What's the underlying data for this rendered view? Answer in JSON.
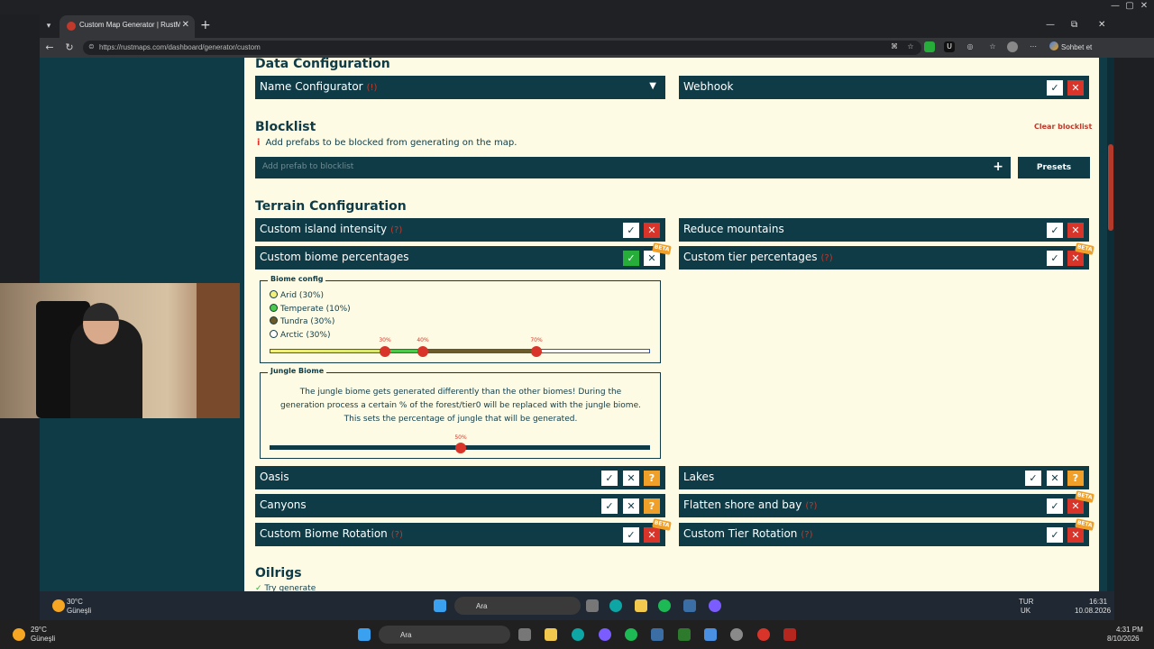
{
  "browser": {
    "tab_title": "Custom Map Generator | RustMaps",
    "url": "https://rustmaps.com/dashboard/generator/custom",
    "chat_button": "Sohbet et"
  },
  "data_config": {
    "title": "Data Configuration",
    "name_configurator": "Name Configurator",
    "name_configurator_hint": "(!)",
    "webhook": "Webhook"
  },
  "blocklist": {
    "title": "Blocklist",
    "clear": "Clear blocklist",
    "info": "Add prefabs to be blocked from generating on the map.",
    "placeholder": "Add prefab to blocklist",
    "presets": "Presets"
  },
  "terrain": {
    "title": "Terrain Configuration",
    "custom_island": "Custom island intensity",
    "reduce_mountains": "Reduce mountains",
    "custom_biome": "Custom biome percentages",
    "custom_tier": "Custom tier percentages",
    "oasis": "Oasis",
    "lakes": "Lakes",
    "canyons": "Canyons",
    "flatten_shore": "Flatten shore and bay",
    "biome_rotation": "Custom Biome Rotation",
    "tier_rotation": "Custom Tier Rotation",
    "help_mark": "(?)",
    "beta": "BETA",
    "question": "?"
  },
  "biome_config": {
    "legend": "Biome config",
    "items": [
      {
        "label": "Arid (30%)",
        "color": "#f3f07a"
      },
      {
        "label": "Temperate (10%)",
        "color": "#4cc94a"
      },
      {
        "label": "Tundra (30%)",
        "color": "#6b5a2a"
      },
      {
        "label": "Arctic (30%)",
        "color": "#ffffff"
      }
    ],
    "handles": [
      "30%",
      "40%",
      "70%"
    ],
    "handle_values": [
      0.3,
      0.4,
      0.7
    ]
  },
  "jungle": {
    "legend": "Jungle Biome",
    "text": "The jungle biome gets generated differently than the other biomes! During the generation process a certain % of the forest/tier0 will be replaced with the jungle biome. This sets the percentage of jungle that will be generated.",
    "slider_label": "50%",
    "slider_value": 0.5
  },
  "oilrigs": {
    "title": "Oilrigs",
    "partial": "Try generate"
  },
  "taskbar": {
    "weather_top_temp": "30°C",
    "weather_top_desc": "Güneşli",
    "search_top": "Ara",
    "lang_top": "TUR",
    "lang_top2": "UK",
    "time_top": "16:31",
    "date_top": "10.08.2026",
    "weather_bottom_temp": "29°C",
    "weather_bottom_desc": "Güneşli",
    "search_bottom": "Ara",
    "time_bottom": "4:31 PM",
    "date_bottom": "8/10/2026"
  }
}
